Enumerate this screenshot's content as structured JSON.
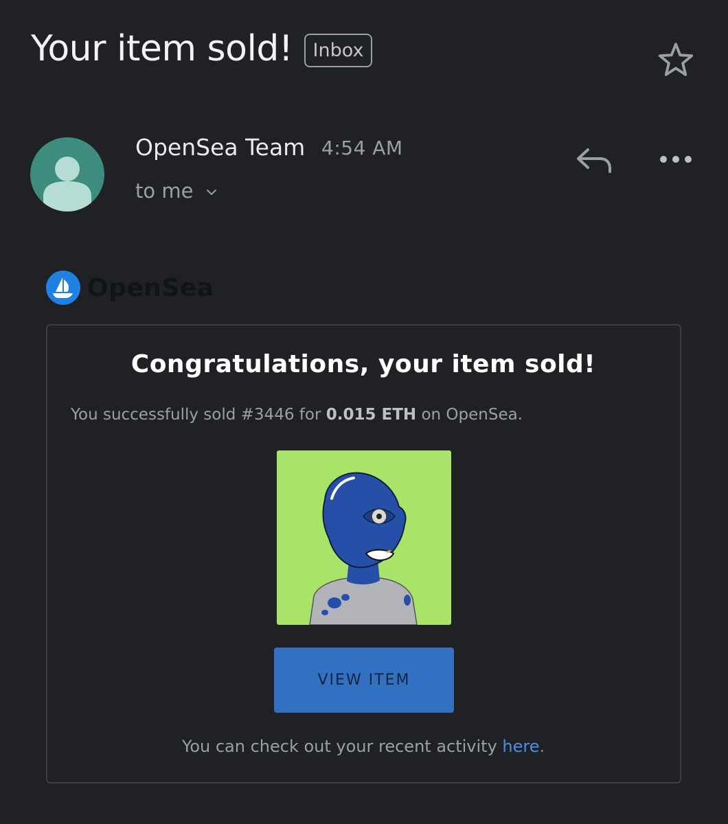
{
  "email": {
    "subject": "Your item sold!",
    "label": "Inbox",
    "star_icon": "star-icon",
    "sender": "OpenSea Team",
    "time": "4:54 AM",
    "recipient": "to me",
    "reply_icon": "reply-icon",
    "more_icon": "more-icon",
    "avatar_color": "#3d8c7e"
  },
  "body": {
    "brand_name": "OpenSea",
    "brand_color": "#2081e2",
    "heading": "Congratulations, your item sold!",
    "summary_prefix": "You successfully sold #3446 for ",
    "summary_amount": "0.015 ETH",
    "summary_suffix": " on OpenSea.",
    "nft_background": "#a8e46a",
    "button_label": "VIEW ITEM",
    "button_color": "#3271c2",
    "footer_text": "You can check out your recent activity ",
    "footer_link": "here",
    "footer_end": ".",
    "link_color": "#4a90e2"
  }
}
